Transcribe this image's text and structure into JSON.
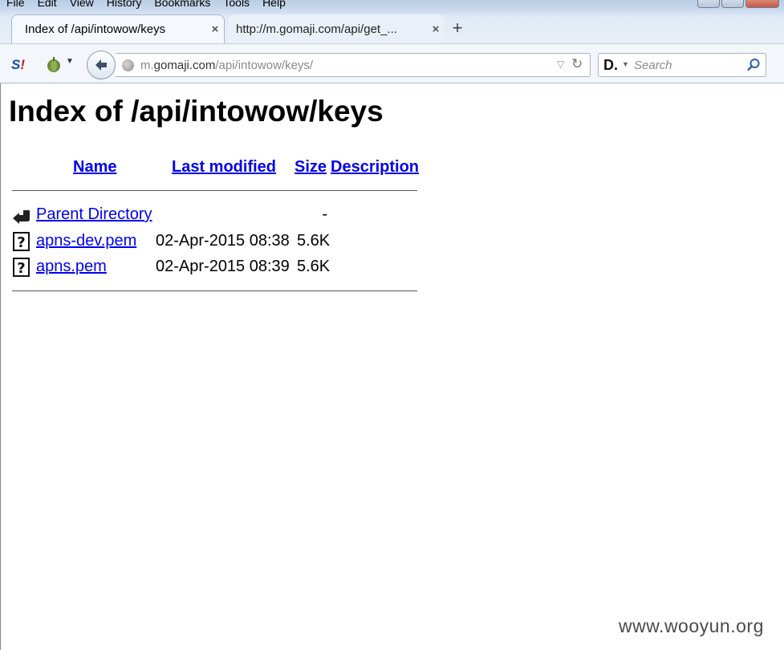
{
  "menubar": [
    "File",
    "Edit",
    "View",
    "History",
    "Bookmarks",
    "Tools",
    "Help"
  ],
  "tabs": [
    {
      "title": "Index of /api/intowow/keys",
      "active": true
    },
    {
      "title": "http://m.gomaji.com/api/get_...",
      "active": false
    }
  ],
  "newtab_symbol": "+",
  "addon": {
    "s_label": "S",
    "s_label2": "!"
  },
  "address": {
    "host": "m.gomaji.com",
    "path": "/api/intowow/keys/",
    "prefix": "m."
  },
  "search": {
    "engine": "D.",
    "placeholder": "Search"
  },
  "page": {
    "title": "Index of /api/intowow/keys",
    "headers": {
      "name": "Name",
      "modified": "Last modified",
      "size": "Size",
      "description": "Description"
    },
    "rows": [
      {
        "icon": "back-arrow-icon",
        "name": "Parent Directory",
        "modified": "",
        "size": "-"
      },
      {
        "icon": "unknown-file-icon",
        "name": "apns-dev.pem",
        "modified": "02-Apr-2015 08:38",
        "size": "5.6K"
      },
      {
        "icon": "unknown-file-icon",
        "name": "apns.pem",
        "modified": "02-Apr-2015 08:39",
        "size": "5.6K"
      }
    ]
  },
  "watermark": "www.wooyun.org",
  "colors": {
    "link": "#0000ee",
    "chrome": "#dfe9f5"
  }
}
